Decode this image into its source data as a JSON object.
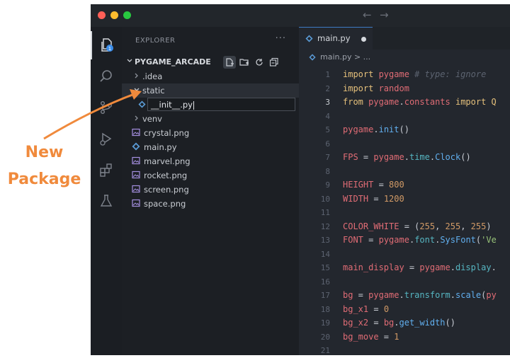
{
  "annotation": {
    "line1": "New",
    "line2": "Package",
    "color": "#f08a3c"
  },
  "window": {
    "traffic_colors": [
      "#fe5f57",
      "#febc2e",
      "#28c840"
    ],
    "nav_back": "←",
    "nav_forward": "→"
  },
  "activity_bar": {
    "items": [
      {
        "name": "explorer-icon",
        "badge": "1",
        "active": true
      },
      {
        "name": "search-icon"
      },
      {
        "name": "source-control-icon"
      },
      {
        "name": "run-debug-icon"
      },
      {
        "name": "extensions-icon"
      },
      {
        "name": "testing-flask-icon"
      }
    ]
  },
  "sidebar": {
    "header": "EXPLORER",
    "more": "···",
    "project": "PYGAME_ARCADE",
    "actions": [
      "new-file-icon",
      "new-folder-icon",
      "refresh-icon",
      "collapse-all-icon"
    ],
    "tree": [
      {
        "label": ".idea",
        "kind": "folder",
        "expanded": false
      },
      {
        "label": "static",
        "kind": "folder",
        "expanded": true
      },
      {
        "label": "venv",
        "kind": "folder",
        "expanded": false
      },
      {
        "label": "crystal.png",
        "kind": "image"
      },
      {
        "label": "main.py",
        "kind": "python"
      },
      {
        "label": "marvel.png",
        "kind": "image"
      },
      {
        "label": "rocket.png",
        "kind": "image"
      },
      {
        "label": "screen.png",
        "kind": "image"
      },
      {
        "label": "space.png",
        "kind": "image"
      }
    ],
    "new_file_input": {
      "value": "__init__.py"
    }
  },
  "editor": {
    "tab": {
      "label": "main.py",
      "modified": true
    },
    "breadcrumb": "main.py > ...",
    "active_line": 3,
    "lines": [
      {
        "n": "1",
        "tokens": [
          [
            "kw",
            "import "
          ],
          [
            "id",
            "pygame"
          ],
          [
            "cm",
            " # type: ignore"
          ]
        ]
      },
      {
        "n": "2",
        "tokens": [
          [
            "kw",
            "import "
          ],
          [
            "id",
            "random"
          ]
        ]
      },
      {
        "n": "3",
        "tokens": [
          [
            "kw",
            "from "
          ],
          [
            "id",
            "pygame"
          ],
          [
            "op",
            "."
          ],
          [
            "id",
            "constants "
          ],
          [
            "kw",
            "import "
          ],
          [
            "kw",
            "Q"
          ]
        ]
      },
      {
        "n": "4",
        "tokens": []
      },
      {
        "n": "5",
        "tokens": [
          [
            "id",
            "pygame"
          ],
          [
            "op",
            "."
          ],
          [
            "fn",
            "init"
          ],
          [
            "op",
            "()"
          ]
        ]
      },
      {
        "n": "6",
        "tokens": []
      },
      {
        "n": "7",
        "tokens": [
          [
            "id",
            "FPS"
          ],
          [
            "op",
            " = "
          ],
          [
            "id",
            "pygame"
          ],
          [
            "op",
            "."
          ],
          [
            "mod",
            "time"
          ],
          [
            "op",
            "."
          ],
          [
            "fn",
            "Clock"
          ],
          [
            "op",
            "()"
          ]
        ]
      },
      {
        "n": "8",
        "tokens": []
      },
      {
        "n": "9",
        "tokens": [
          [
            "id",
            "HEIGHT"
          ],
          [
            "op",
            " = "
          ],
          [
            "num",
            "800"
          ]
        ]
      },
      {
        "n": "10",
        "tokens": [
          [
            "id",
            "WIDTH"
          ],
          [
            "op",
            " = "
          ],
          [
            "num",
            "1200"
          ]
        ]
      },
      {
        "n": "11",
        "tokens": []
      },
      {
        "n": "12",
        "tokens": [
          [
            "id",
            "COLOR_WHITE"
          ],
          [
            "op",
            " = ("
          ],
          [
            "num",
            "255"
          ],
          [
            "op",
            ", "
          ],
          [
            "num",
            "255"
          ],
          [
            "op",
            ", "
          ],
          [
            "num",
            "255"
          ],
          [
            "op",
            ")"
          ]
        ]
      },
      {
        "n": "13",
        "tokens": [
          [
            "id",
            "FONT"
          ],
          [
            "op",
            " = "
          ],
          [
            "id",
            "pygame"
          ],
          [
            "op",
            "."
          ],
          [
            "mod",
            "font"
          ],
          [
            "op",
            "."
          ],
          [
            "fn",
            "SysFont"
          ],
          [
            "op",
            "("
          ],
          [
            "str",
            "'Ve"
          ]
        ]
      },
      {
        "n": "14",
        "tokens": []
      },
      {
        "n": "15",
        "tokens": [
          [
            "id",
            "main_display"
          ],
          [
            "op",
            " = "
          ],
          [
            "id",
            "pygame"
          ],
          [
            "op",
            "."
          ],
          [
            "mod",
            "display"
          ],
          [
            "op",
            "."
          ]
        ]
      },
      {
        "n": "16",
        "tokens": []
      },
      {
        "n": "17",
        "tokens": [
          [
            "id",
            "bg"
          ],
          [
            "op",
            " = "
          ],
          [
            "id",
            "pygame"
          ],
          [
            "op",
            "."
          ],
          [
            "mod",
            "transform"
          ],
          [
            "op",
            "."
          ],
          [
            "fn",
            "scale"
          ],
          [
            "op",
            "("
          ],
          [
            "id",
            "py"
          ]
        ]
      },
      {
        "n": "18",
        "tokens": [
          [
            "id",
            "bg_x1"
          ],
          [
            "op",
            " = "
          ],
          [
            "num",
            "0"
          ]
        ]
      },
      {
        "n": "19",
        "tokens": [
          [
            "id",
            "bg_x2"
          ],
          [
            "op",
            " = "
          ],
          [
            "id",
            "bg"
          ],
          [
            "op",
            "."
          ],
          [
            "fn",
            "get_width"
          ],
          [
            "op",
            "()"
          ]
        ]
      },
      {
        "n": "20",
        "tokens": [
          [
            "id",
            "bg_move"
          ],
          [
            "op",
            " = "
          ],
          [
            "num",
            "1"
          ]
        ]
      },
      {
        "n": "21",
        "tokens": []
      }
    ]
  }
}
